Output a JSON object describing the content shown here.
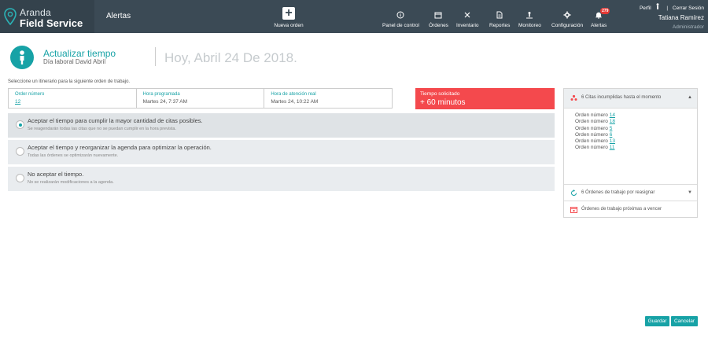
{
  "brand": {
    "line1": "Aranda",
    "line2": "Field Service"
  },
  "header": {
    "section_title": "Alertas"
  },
  "new_order": {
    "label": "Nueva orden"
  },
  "nav": [
    {
      "label": "Panel de control",
      "icon": "info-icon"
    },
    {
      "label": "Órdenes",
      "icon": "calendar-icon"
    },
    {
      "label": "Inventario",
      "icon": "inventory-icon"
    },
    {
      "label": "Reportes",
      "icon": "report-icon"
    },
    {
      "label": "Monitoreo",
      "icon": "person-pin-icon"
    },
    {
      "label": "Configuración",
      "icon": "gear-icon"
    },
    {
      "label": "Alertas",
      "icon": "bell-icon",
      "badge": "279"
    }
  ],
  "user": {
    "profile_label": "Perfil",
    "separator": "|",
    "logout_label": "Cerrar Sesión",
    "name": "Tatiana Ramírez",
    "role": "Administrador"
  },
  "page": {
    "title": "Actualizar tiempo",
    "subtitle": "Día laboral David Abril",
    "date": "Hoy, Abril 24 De 2018.",
    "instruction": "Seleccione un itinerario para la siguiente orden de trabajo."
  },
  "info": [
    {
      "header": "Order número",
      "value": "12",
      "link": true
    },
    {
      "header": "Hora programada",
      "value": "Martes 24, 7:37 AM",
      "link": false
    },
    {
      "header": "Hora de atención real",
      "value": "Martes 24, 10:22 AM",
      "link": false
    }
  ],
  "time_requested": {
    "header": "Tiempo solicitado",
    "value": "+ 60 minutos"
  },
  "options": [
    {
      "title": "Aceptar el tiempo para cumplir la mayor cantidad de citas posibles.",
      "desc": "Se reagendarán todas las citas que no se puedan cumplir en la hora prevista.",
      "selected": true
    },
    {
      "title": "Aceptar el tiempo y reorganizar la agenda para optimizar la operación.",
      "desc": "Todas las órdenes se optimizarán nuevamente.",
      "selected": false
    },
    {
      "title": "No aceptar el tiempo.",
      "desc": "No se realizarán modificaciones a la agenda.",
      "selected": false
    }
  ],
  "right_panel": {
    "missed_header": "6 Citas incumplidas hasta el momento",
    "missed_prefix": "Orden número",
    "missed_orders": [
      "14",
      "18",
      "5",
      "6",
      "13",
      "11"
    ],
    "reassign_header": "6 Órdenes de trabajo por reasignar",
    "expiring_header": "Órdenes de trabajo próximas a vencer"
  },
  "buttons": {
    "save": "Guardar",
    "cancel": "Cancelar"
  },
  "colors": {
    "accent": "#17a2a6",
    "topbar": "#3b4a55",
    "alert": "#f4494d"
  }
}
